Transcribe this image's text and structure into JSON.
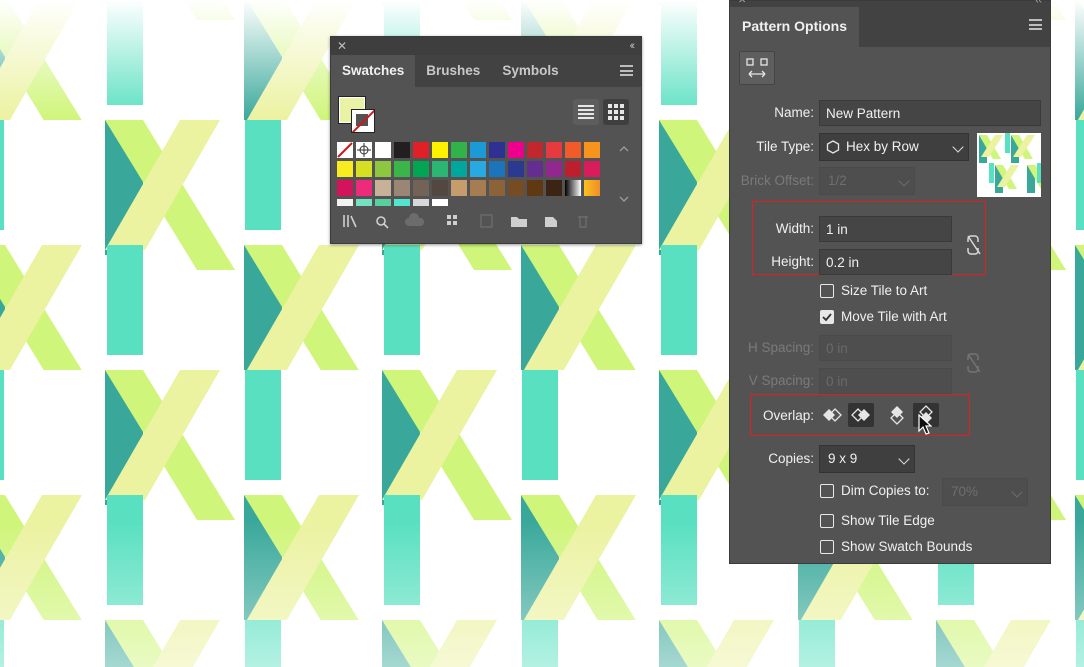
{
  "swatches_panel": {
    "tabs": [
      "Swatches",
      "Brushes",
      "Symbols"
    ],
    "active_tab": "Swatches",
    "view_mode": "grid",
    "fill_color": "#eaf2a5",
    "swatch_colors": [
      [
        "#ffffff",
        "#ffffff",
        "#ffffff",
        "#231f20",
        "#e11f27",
        "#fff200",
        "#32b34a",
        "#1b9ad6",
        "#2e3192",
        "#ec008c",
        "#c1272d",
        "#e53a40",
        "#f15a29",
        "#f7941d"
      ],
      [
        "#f7ec1f",
        "#d7df23",
        "#8dc63f",
        "#39b54a",
        "#00a651",
        "#2bb673",
        "#00a79d",
        "#27aae1",
        "#1c75bc",
        "#2b3990",
        "#662d91",
        "#92278f",
        "#be1e2d",
        "#d91c5c"
      ],
      [
        "#d4145a",
        "#ee2a7b",
        "#c7b299",
        "#998675",
        "#736357",
        "#534741",
        "#c69c6d",
        "#a67c52",
        "#8c6239",
        "#754c24",
        "#603913",
        "#3c2415",
        "#bcbec0",
        "#e6e6e6"
      ],
      [
        "#f2f2f2",
        "#75e1c1",
        "#58cf9e",
        "#52e5d0",
        "#d8d8d8",
        "#ffffff"
      ]
    ],
    "icons": [
      "swatch-libraries-icon",
      "show-swatch-kinds-icon",
      "swatch-options-icon",
      "cc-libraries-icon",
      "new-color-group-icon",
      "edit-color-group-icon",
      "new-group-folder-icon",
      "new-swatch-icon",
      "delete-swatch-icon"
    ]
  },
  "pattern_options": {
    "title": "Pattern Options",
    "name_label": "Name:",
    "name_value": "New Pattern",
    "tile_type_label": "Tile Type:",
    "tile_type_value": "Hex by Row",
    "brick_offset_label": "Brick Offset:",
    "brick_offset_value": "1/2",
    "width_label": "Width:",
    "width_value": "1 in",
    "height_label": "Height:",
    "height_value": "0.2 in",
    "size_tile_to_art_label": "Size Tile to Art",
    "size_tile_to_art_checked": false,
    "move_tile_with_art_label": "Move Tile with Art",
    "move_tile_with_art_checked": true,
    "h_spacing_label": "H Spacing:",
    "h_spacing_value": "0 in",
    "v_spacing_label": "V Spacing:",
    "v_spacing_value": "0 in",
    "overlap_label": "Overlap:",
    "copies_label": "Copies:",
    "copies_value": "9 x 9",
    "dim_copies_label": "Dim Copies to:",
    "dim_copies_checked": false,
    "dim_copies_value": "70%",
    "show_tile_edge_label": "Show Tile Edge",
    "show_tile_edge_checked": false,
    "show_swatch_bounds_label": "Show Swatch Bounds",
    "show_swatch_bounds_checked": false,
    "highlight_color": "#e02020"
  },
  "pattern_colors": {
    "teal": "#39a89a",
    "aqua": "#58e0c0",
    "lime": "#cff57a",
    "pale": "#ebf2a0"
  }
}
